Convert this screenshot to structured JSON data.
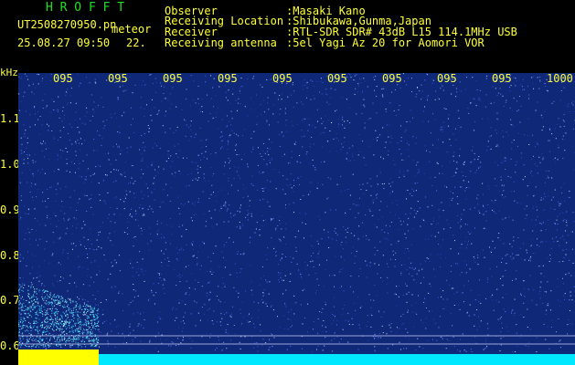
{
  "header": {
    "brand": "H R O F F T",
    "filename": "UT2508270950.pn",
    "mode": "meteor",
    "datetime": "25.08.27 09:50",
    "extra": "22.",
    "fields": [
      {
        "label": "Observer",
        "value": ":Masaki Kano"
      },
      {
        "label": "Receiving Location",
        "value": ":Shibukawa,Gunma,Japan"
      },
      {
        "label": "Receiver",
        "value": ":RTL-SDR SDR# 43dB L15 114.1MHz USB"
      },
      {
        "label": "Receiving antenna",
        "value": ":5el Yagi Az 20 for Aomori VOR"
      }
    ]
  },
  "axes": {
    "y_unit": "kHz",
    "y_ticks": [
      "1.1",
      "1.0",
      "0.9",
      "0.8",
      "0.7",
      "0.6"
    ],
    "x_ticks": [
      "095",
      "095",
      "095",
      "095",
      "095",
      "095",
      "095",
      "095",
      "095",
      "1000"
    ]
  },
  "colors": {
    "background": "#000000",
    "label": "#ffff3a",
    "brand": "#20e020",
    "waterfall_base": "#102878",
    "noise": "#6a88ff",
    "floor": "#00e8ff",
    "burst": "#ffff00"
  }
}
